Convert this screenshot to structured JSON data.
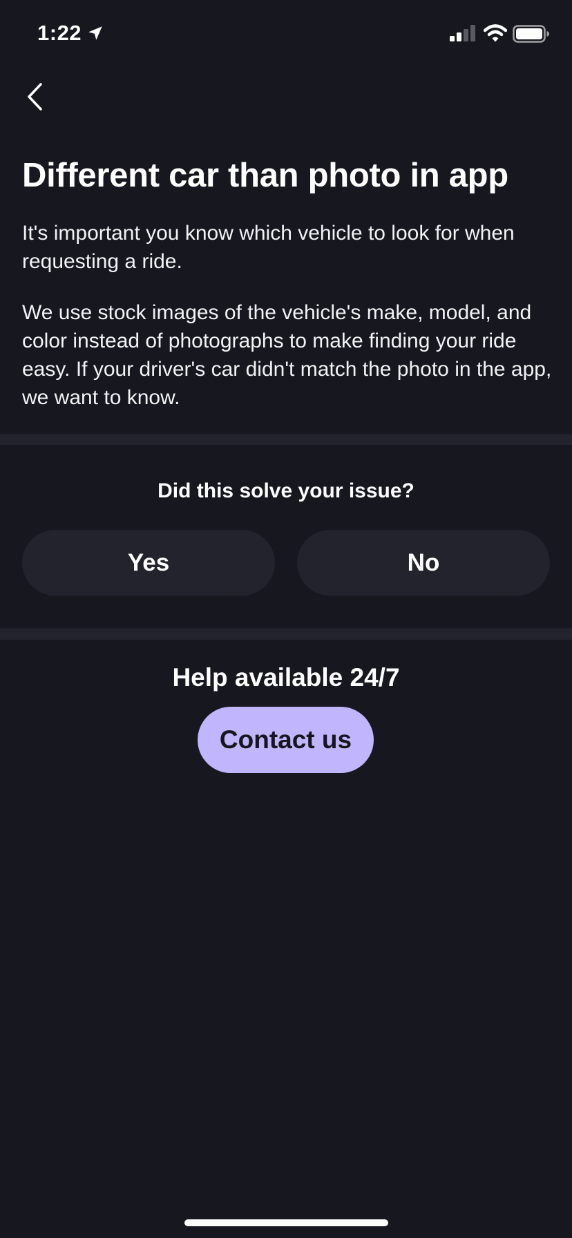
{
  "status_bar": {
    "time": "1:22",
    "icons": [
      "location-arrow-icon",
      "cellular-signal-icon",
      "wifi-icon",
      "battery-icon"
    ]
  },
  "nav": {
    "back_icon": "chevron-left-icon"
  },
  "article": {
    "title": "Different car than photo in app",
    "paragraphs": [
      "It's important you know which vehicle to look for when requesting a ride.",
      "We use stock images of the vehicle's make, model, and color instead of photographs to make finding your ride easy. If your driver's car didn't match the photo in the app, we want to know."
    ]
  },
  "feedback": {
    "question": "Did this solve your issue?",
    "yes_label": "Yes",
    "no_label": "No"
  },
  "help": {
    "text": "Help available 24/7",
    "contact_label": "Contact us"
  },
  "colors": {
    "background": "#171720",
    "surface": "#23232d",
    "accent": "#c1b5fd",
    "text": "#ffffff"
  }
}
